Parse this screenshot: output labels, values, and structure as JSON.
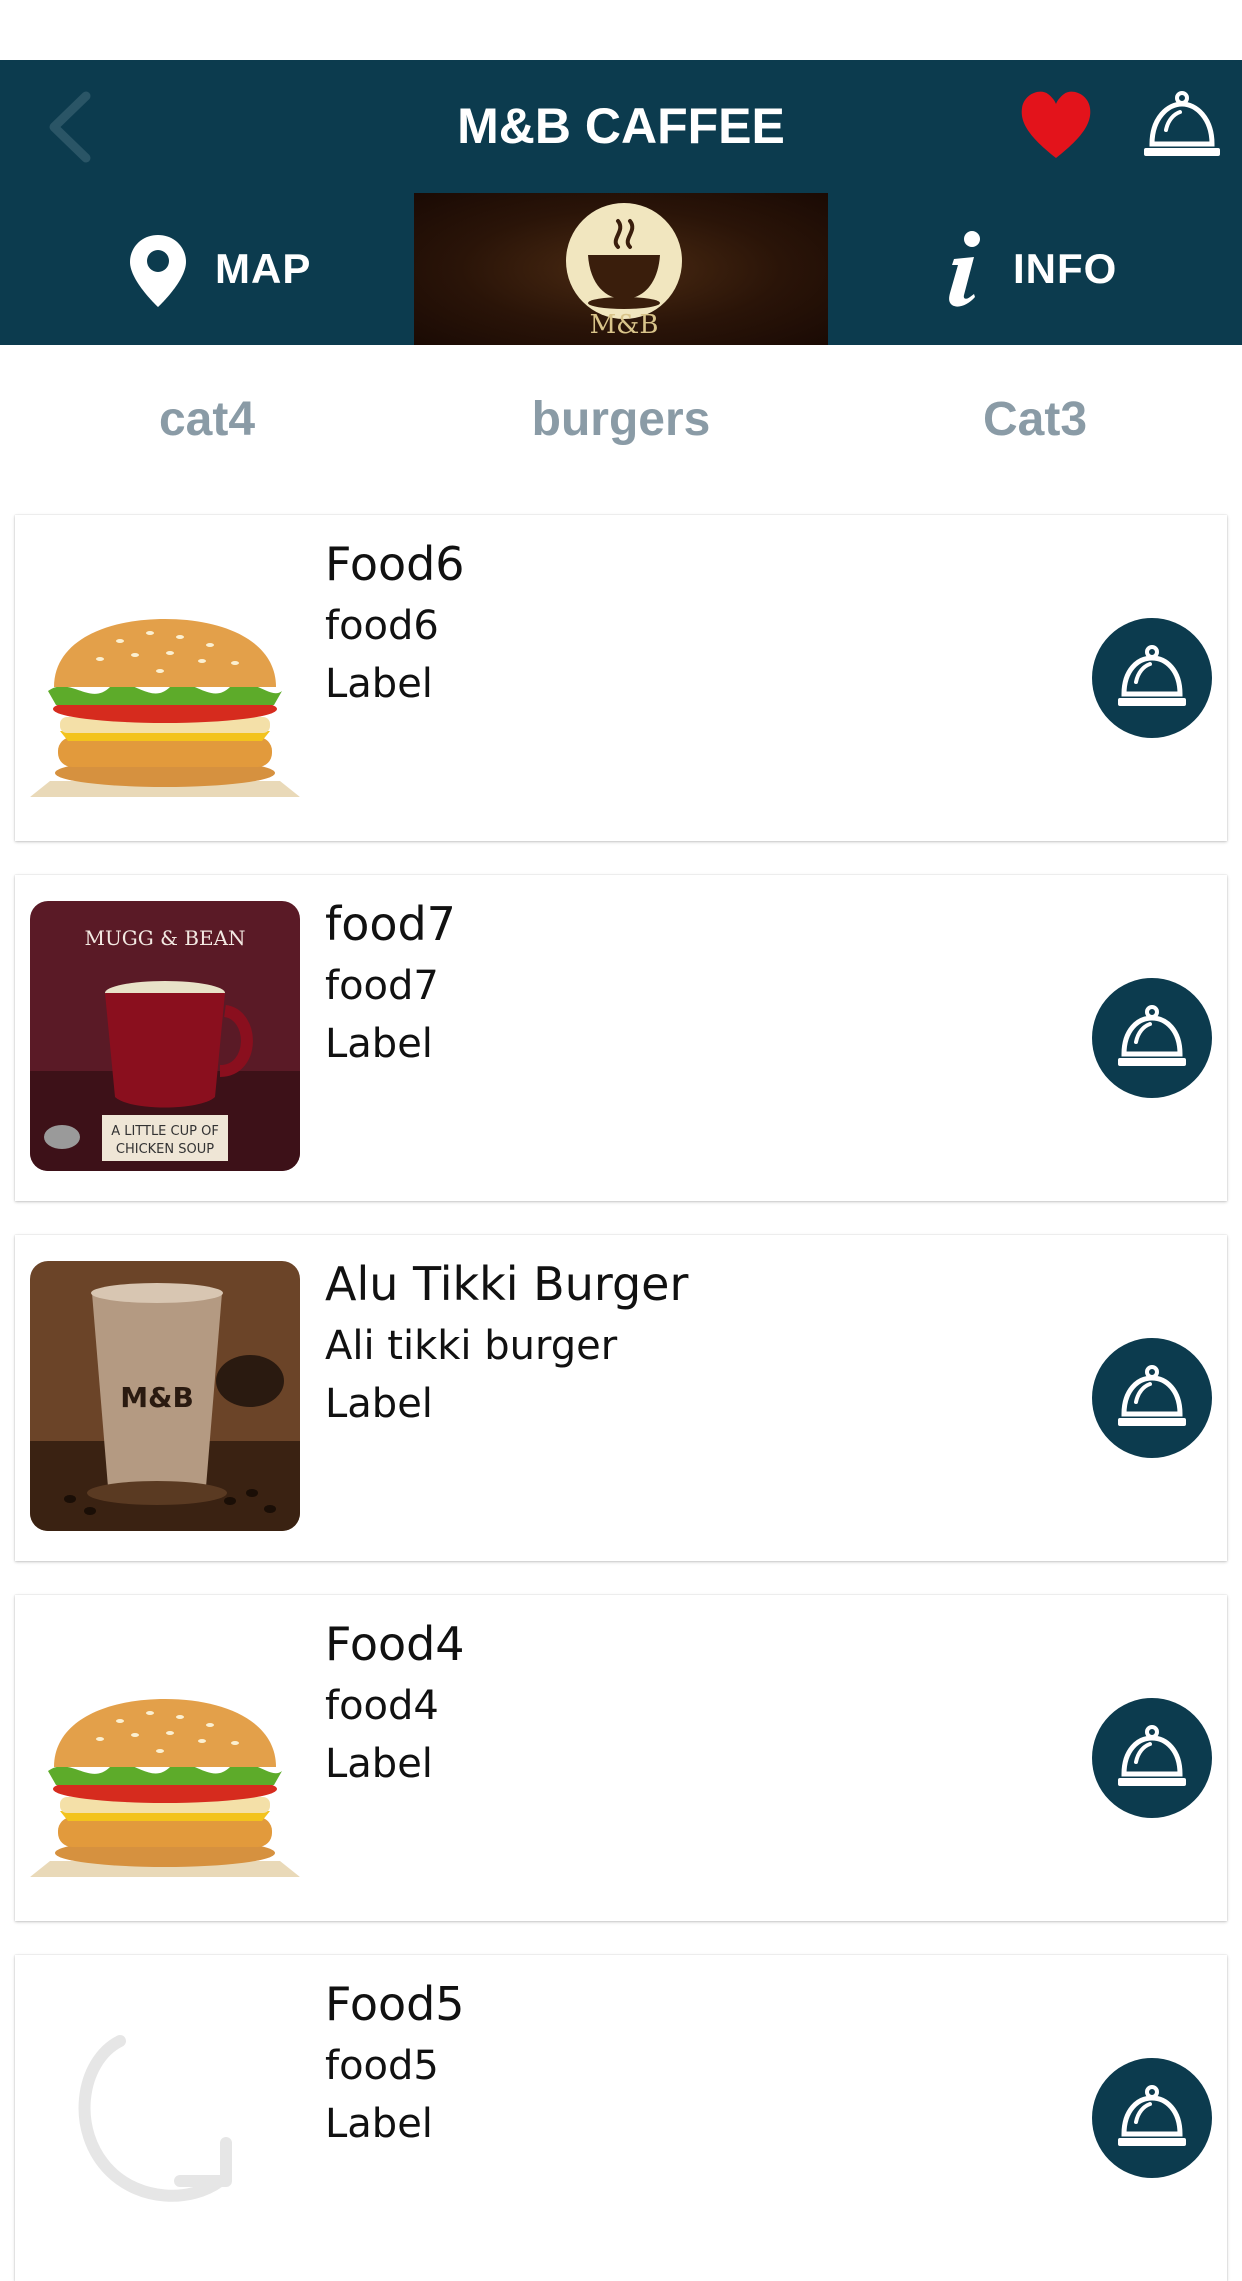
{
  "header": {
    "title": "M&B CAFFEE",
    "back_icon": "chevron-left-icon",
    "favorite_icon": "heart-icon",
    "order_icon": "service-bell-icon"
  },
  "toolbar": {
    "map_label": "MAP",
    "info_label": "INFO",
    "logo_text": "M&B"
  },
  "tabs": [
    {
      "label": "cat4"
    },
    {
      "label": "burgers"
    },
    {
      "label": "Cat3"
    }
  ],
  "items": [
    {
      "title": "Food6",
      "subtitle": "food6",
      "label": "Label",
      "image": "burger"
    },
    {
      "title": "food7",
      "subtitle": "food7",
      "label": "Label",
      "image": "soup-mug"
    },
    {
      "title": "Alu Tikki Burger",
      "subtitle": "Ali tikki burger",
      "label": "Label",
      "image": "iced-coffee"
    },
    {
      "title": "Food4",
      "subtitle": "food4",
      "label": "Label",
      "image": "burger"
    },
    {
      "title": "Food5",
      "subtitle": "food5",
      "label": "Label",
      "image": "loading-spinner"
    }
  ],
  "colors": {
    "primary": "#0c3b4e",
    "tab_text": "#8a9ba6",
    "heart": "#e3131b"
  }
}
